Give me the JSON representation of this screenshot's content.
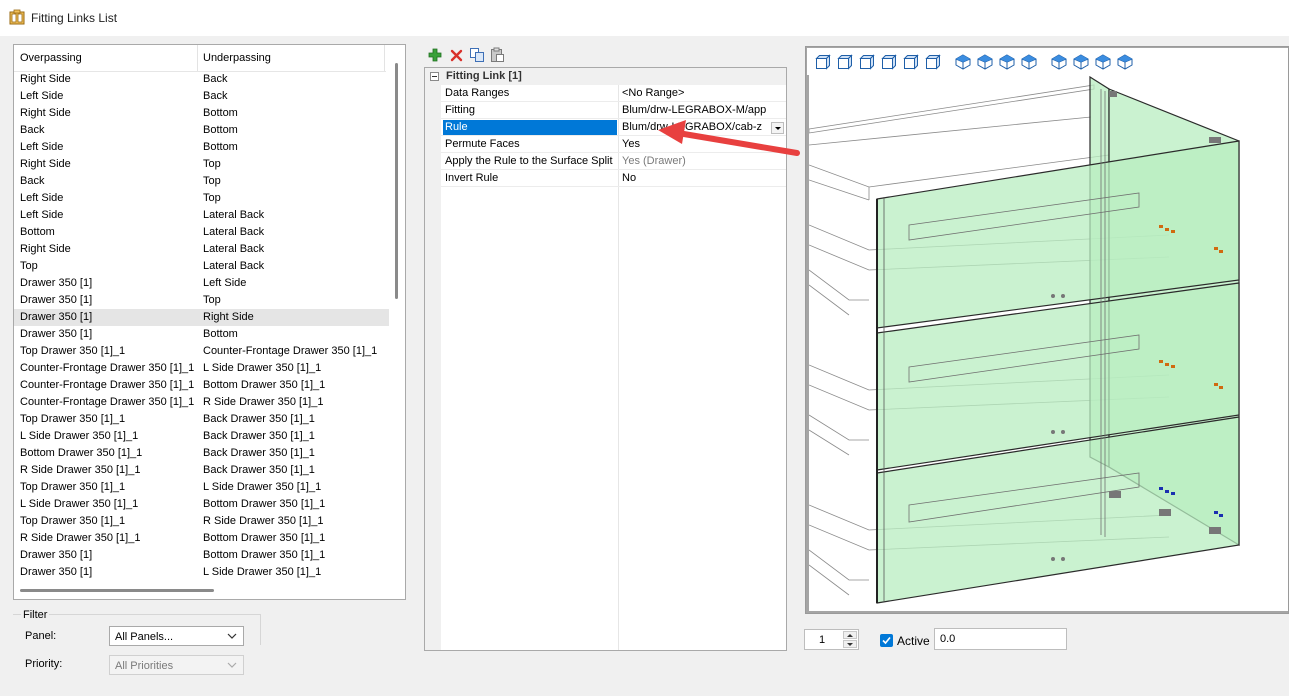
{
  "window": {
    "title": "Fitting Links List"
  },
  "links_table": {
    "columns": [
      "Overpassing",
      "Underpassing"
    ],
    "rows": [
      [
        "Right Side",
        "Back"
      ],
      [
        "Left Side",
        "Back"
      ],
      [
        "Right Side",
        "Bottom"
      ],
      [
        "Back",
        "Bottom"
      ],
      [
        "Left Side",
        "Bottom"
      ],
      [
        "Right Side",
        "Top"
      ],
      [
        "Back",
        "Top"
      ],
      [
        "Left Side",
        "Top"
      ],
      [
        "Left Side",
        "Lateral Back"
      ],
      [
        "Bottom",
        "Lateral Back"
      ],
      [
        "Right Side",
        "Lateral Back"
      ],
      [
        "Top",
        "Lateral Back"
      ],
      [
        "Drawer 350 [1]",
        "Left Side"
      ],
      [
        "Drawer 350 [1]",
        "Top"
      ],
      [
        "Drawer 350 [1]",
        "Right Side"
      ],
      [
        "Drawer 350 [1]",
        "Bottom"
      ],
      [
        "Top Drawer 350 [1]_1",
        "Counter-Frontage Drawer 350 [1]_1"
      ],
      [
        "Counter-Frontage Drawer 350 [1]_1",
        "L Side Drawer 350 [1]_1"
      ],
      [
        "Counter-Frontage Drawer 350 [1]_1",
        "Bottom Drawer 350 [1]_1"
      ],
      [
        "Counter-Frontage Drawer 350 [1]_1",
        "R Side Drawer 350 [1]_1"
      ],
      [
        "Top Drawer 350 [1]_1",
        "Back Drawer 350 [1]_1"
      ],
      [
        "L Side Drawer 350 [1]_1",
        "Back Drawer 350 [1]_1"
      ],
      [
        "Bottom Drawer 350 [1]_1",
        "Back Drawer 350 [1]_1"
      ],
      [
        "R Side Drawer 350 [1]_1",
        "Back Drawer 350 [1]_1"
      ],
      [
        "Top Drawer 350 [1]_1",
        "L Side Drawer 350 [1]_1"
      ],
      [
        "L Side Drawer 350 [1]_1",
        "Bottom Drawer 350 [1]_1"
      ],
      [
        "Top Drawer 350 [1]_1",
        "R Side Drawer 350 [1]_1"
      ],
      [
        "R Side Drawer 350 [1]_1",
        "Bottom Drawer 350 [1]_1"
      ],
      [
        "Drawer 350 [1]",
        "Bottom Drawer 350 [1]_1"
      ],
      [
        "Drawer 350 [1]",
        "L Side Drawer 350 [1]_1"
      ]
    ],
    "selected_row": 14
  },
  "filter": {
    "title": "Filter",
    "panel_label": "Panel:",
    "panel_value": "All Panels...",
    "priority_label": "Priority:",
    "priority_value": "All Priorities"
  },
  "toolbar": {
    "icons": [
      "add-icon",
      "delete-icon",
      "copy-icon",
      "paste-icon"
    ]
  },
  "properties": {
    "category": "Fitting Link [1]",
    "items": [
      {
        "name": "Data Ranges",
        "value": "<No Range>"
      },
      {
        "name": "Fitting",
        "value": "Blum/drw-LEGRABOX-M/app"
      },
      {
        "name": "Rule",
        "value": "Blum/drw-LEGRABOX/cab-z"
      },
      {
        "name": "Permute Faces",
        "value": "Yes"
      },
      {
        "name": "Apply the Rule to the Surface Split",
        "value": "Yes (Drawer)"
      },
      {
        "name": "Invert Rule",
        "value": "No"
      }
    ],
    "selected": "Rule"
  },
  "annotation": {
    "color": "#e8403f"
  },
  "viewport": {
    "view_buttons": [
      "view-front-icon",
      "view-back-icon",
      "view-left-icon",
      "view-right-icon",
      "view-top-icon",
      "view-bottom-icon",
      "iso-sw-icon",
      "iso-se-icon",
      "iso-ne-icon",
      "iso-nw-icon",
      "dimetric-1-icon",
      "dimetric-2-icon",
      "dimetric-3-icon",
      "dimetric-4-icon"
    ],
    "panel_fill": "#b8eec0"
  },
  "bottom": {
    "spin_value": "1",
    "active_label": "Active",
    "active_checked": true,
    "value": "0.0"
  }
}
